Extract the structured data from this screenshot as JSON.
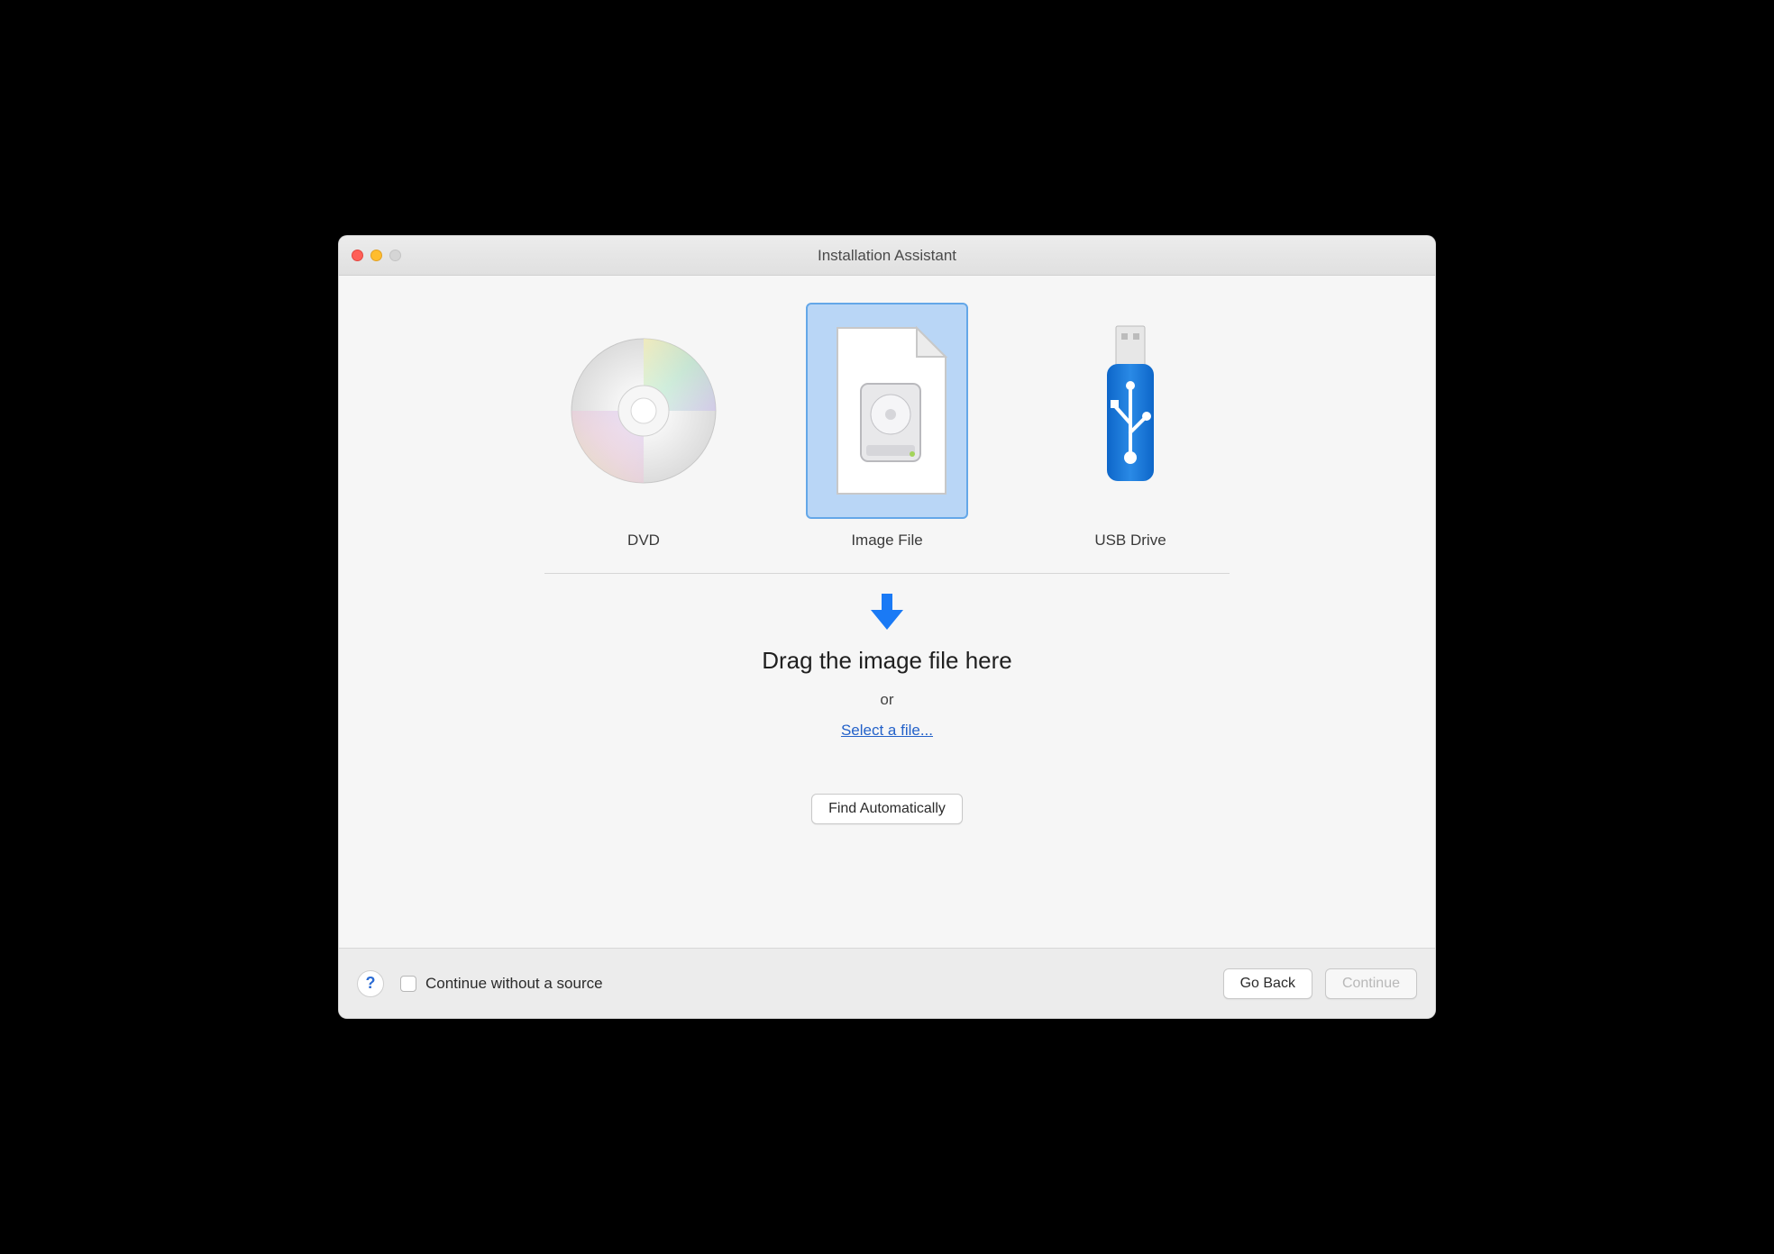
{
  "window": {
    "title": "Installation Assistant"
  },
  "options": {
    "dvd": {
      "label": "DVD"
    },
    "image_file": {
      "label": "Image File"
    },
    "usb_drive": {
      "label": "USB Drive"
    }
  },
  "drop": {
    "drag_text": "Drag the image file here",
    "or_text": "or",
    "select_link": "Select a file..."
  },
  "buttons": {
    "find_auto": "Find Automatically",
    "go_back": "Go Back",
    "continue": "Continue"
  },
  "checkbox": {
    "continue_without_source": "Continue without a source"
  },
  "help": {
    "label": "?"
  }
}
